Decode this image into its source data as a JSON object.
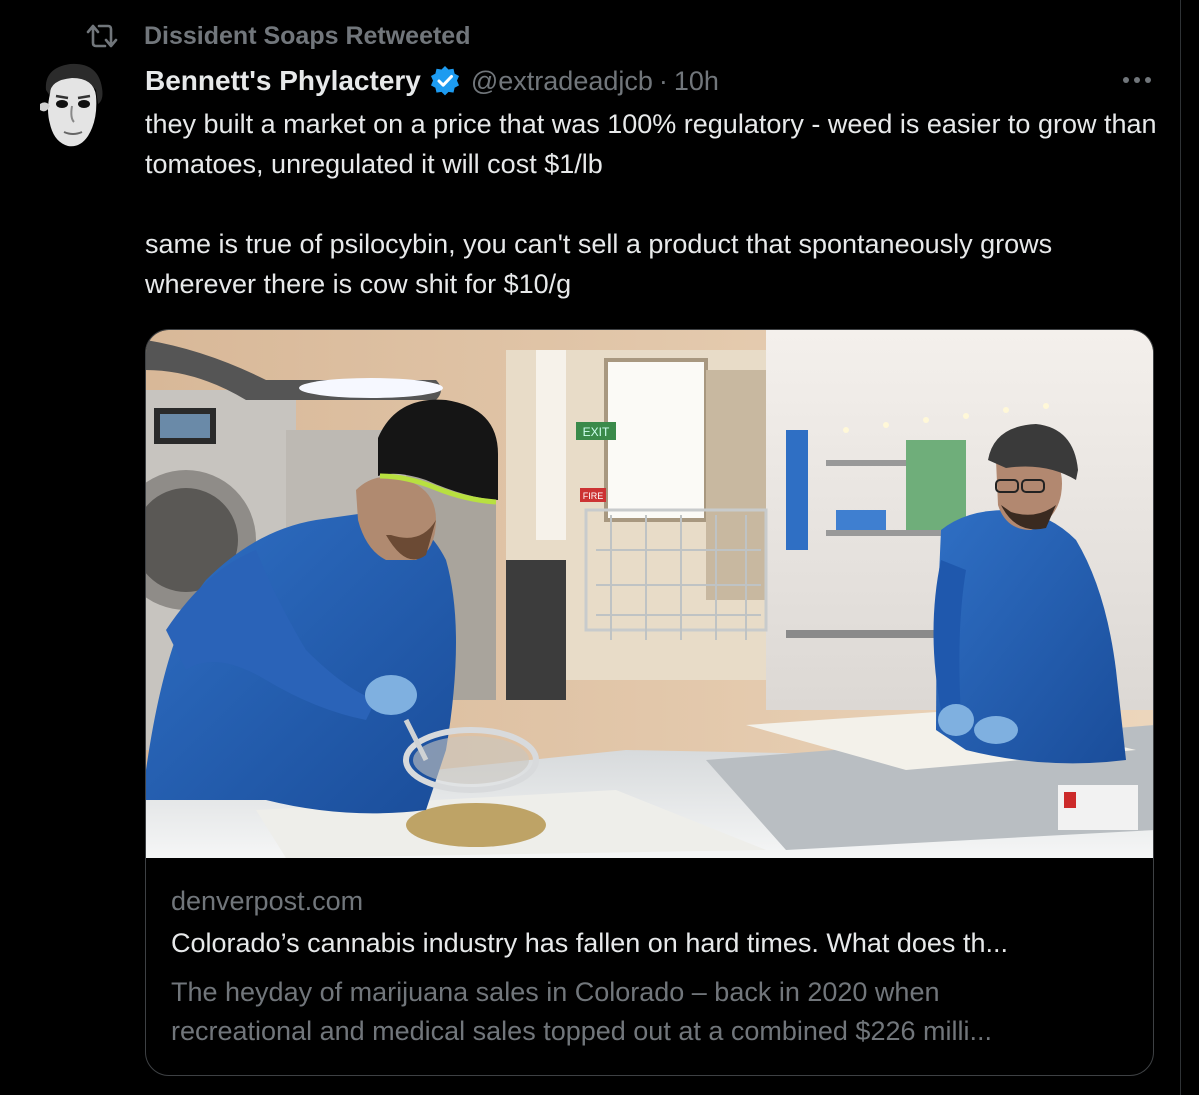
{
  "retweet": {
    "icon": "retweet-icon",
    "text": "Dissident Soaps Retweeted"
  },
  "author": {
    "avatar_icon": "avatar-portrait",
    "display_name": "Bennett's Phylactery",
    "verified_icon": "verified-badge-icon",
    "handle": "@extradeadjcb",
    "separator": "·",
    "time": "10h"
  },
  "more_icon": "more-options-icon",
  "tweet": {
    "paragraph1": "they built a market on a price that was 100% regulatory - weed is easier to grow than tomatoes, unregulated it will cost $1/lb",
    "paragraph2": "same is true of psilocybin, you can't sell a product that spontaneously grows wherever there is cow shit for $10/g"
  },
  "card": {
    "image_icon": "lab-workers-photo",
    "image_signs": {
      "exit": "EXIT",
      "fire": "FIRE"
    },
    "domain": "denverpost.com",
    "title": "Colorado’s cannabis industry has fallen on hard times. What does th...",
    "description_line1": "The heyday of marijuana sales in Colorado – back in 2020 when",
    "description_line2": "recreational and medical sales topped out at a combined $226 milli..."
  },
  "colors": {
    "background": "#000000",
    "primary_text": "#e7e9ea",
    "secondary_text": "#71767b",
    "verified": "#1d9bf0",
    "border": "#3e4144"
  }
}
